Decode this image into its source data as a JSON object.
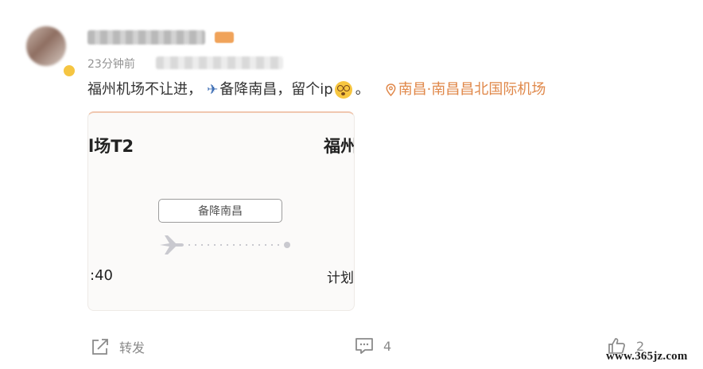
{
  "post": {
    "time_ago": "23分钟前",
    "text_before_icon": "福州机场不让进，",
    "text_after_icon": "备降南昌，留个ip",
    "text_end": "。",
    "location": "南昌·南昌昌北国际机场"
  },
  "card": {
    "left_title": "l场T2",
    "right_title": "福州",
    "status": "备降南昌",
    "left_time": ":40",
    "right_label": "计划"
  },
  "actions": {
    "forward_label": "转发",
    "comment_count": "4",
    "like_count": "2"
  },
  "watermark": "www.365jz.com",
  "colors": {
    "location": "#e0884a",
    "action_gray": "#8a8a8a",
    "text": "#333333",
    "meta": "#939393"
  },
  "icons": [
    "avatar",
    "vip-badge",
    "airplane-icon",
    "dizzy-face-emoji",
    "location-pin-icon",
    "share-icon",
    "comment-icon",
    "like-icon"
  ]
}
